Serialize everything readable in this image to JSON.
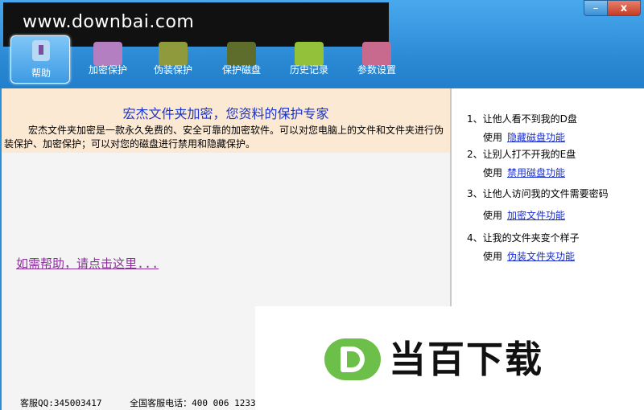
{
  "watermark": "www.downbai.com",
  "window_controls": {
    "minimize": "–",
    "close": "x"
  },
  "toolbar": {
    "items": [
      {
        "label": "帮助",
        "icon": "help-icon",
        "color": "#b8d9f2"
      },
      {
        "label": "加密保护",
        "icon": "lock-icon",
        "color": "#b47fc0"
      },
      {
        "label": "伪装保护",
        "icon": "disguise-icon",
        "color": "#8f9a3d"
      },
      {
        "label": "保护磁盘",
        "icon": "disk-icon",
        "color": "#5f6d2c"
      },
      {
        "label": "历史记录",
        "icon": "history-icon",
        "color": "#93c23a"
      },
      {
        "label": "参数设置",
        "icon": "settings-icon",
        "color": "#c86a8e"
      }
    ]
  },
  "info": {
    "title": "宏杰文件夹加密，您资料的保护专家",
    "description": "宏杰文件夹加密是一款永久免费的、安全可靠的加密软件。可以对您电脑上的文件和文件夹进行伪装保护、加密保护；可以对您的磁盘进行禁用和隐藏保护。"
  },
  "help_link": "如需帮助，请点击这里...",
  "footer": {
    "qq": "客服QQ:345003417",
    "phone": "全国客服电话：400 006 1233"
  },
  "tips": [
    {
      "question": "1、让他人看不到我的D盘",
      "use": "使用",
      "link": "隐藏磁盘功能"
    },
    {
      "question": "2、让别人打不开我的E盘",
      "use": "使用",
      "link": "禁用磁盘功能"
    },
    {
      "question": "3、让他人访问我的文件需要密码",
      "use": "使用",
      "link": "加密文件功能"
    },
    {
      "question": "4、让我的文件夹变个样子",
      "use": "使用",
      "link": "伪装文件夹功能"
    }
  ],
  "logo": {
    "text": "当百下载"
  }
}
